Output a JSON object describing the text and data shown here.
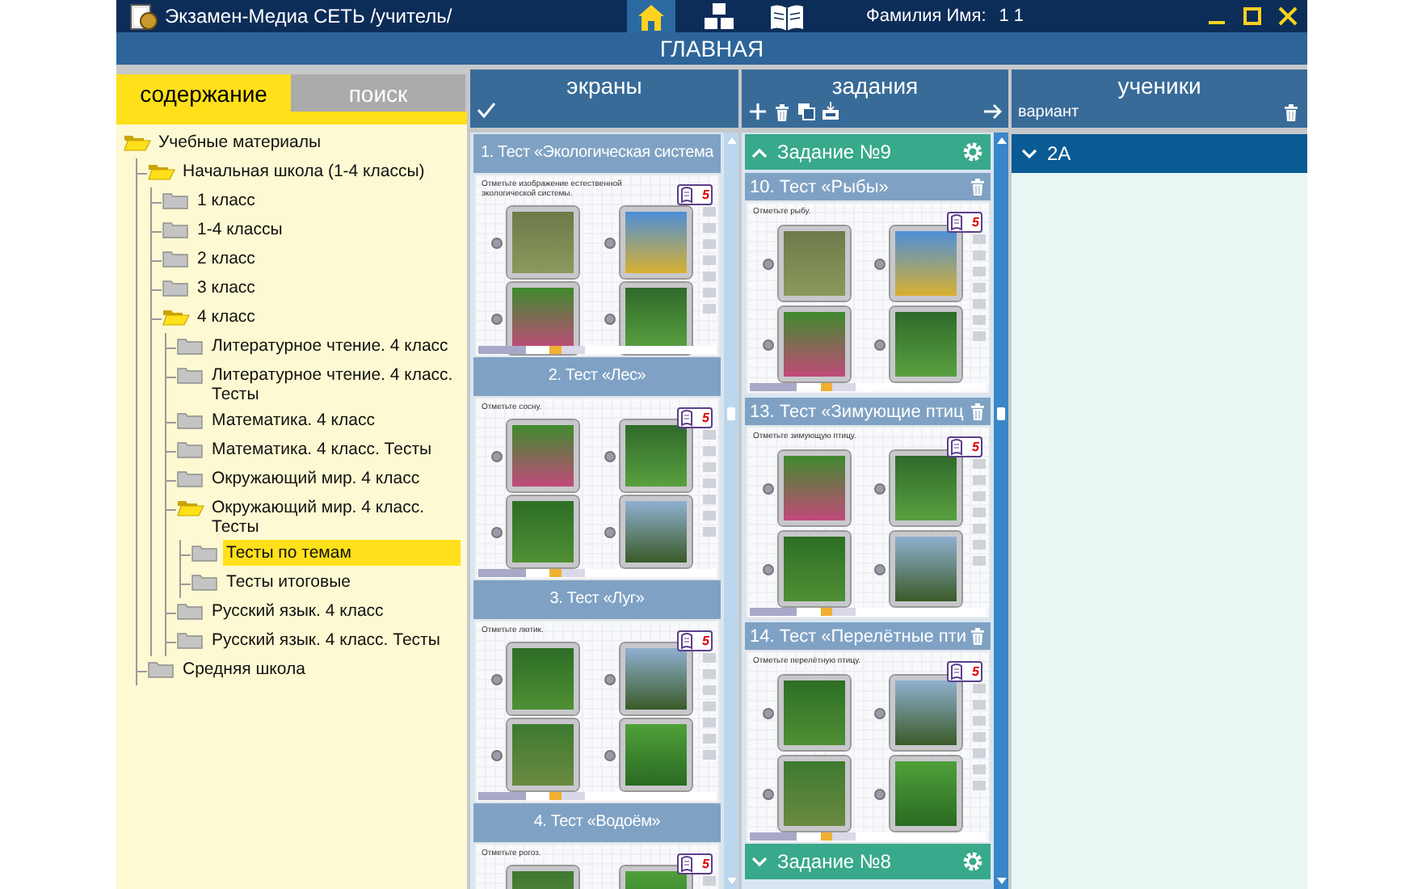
{
  "window": {
    "title": "Экзамен-Медиа СЕТЬ /учитель/",
    "user_label": "Фамилия Имя:",
    "user_value": "1 1"
  },
  "nav": [
    {
      "kind": "home",
      "selected": true
    },
    {
      "kind": "blocks",
      "selected": false
    },
    {
      "kind": "book",
      "selected": false
    }
  ],
  "page_title": "ГЛАВНАЯ",
  "left_tabs": [
    {
      "label": "содержание",
      "selected": true
    },
    {
      "label": "поиск",
      "selected": false
    }
  ],
  "tree": [
    {
      "label": "Учебные материалы",
      "expanded": true,
      "selected": false,
      "children": [
        {
          "label": "Начальная школа (1-4 классы)",
          "expanded": true,
          "selected": false,
          "children": [
            {
              "label": "1 класс",
              "expanded": false,
              "selected": false
            },
            {
              "label": "1-4 классы",
              "expanded": false,
              "selected": false
            },
            {
              "label": "2 класс",
              "expanded": false,
              "selected": false
            },
            {
              "label": "3 класс",
              "expanded": false,
              "selected": false
            },
            {
              "label": "4 класс",
              "expanded": true,
              "selected": false,
              "children": [
                {
                  "label": "Литературное чтение. 4 класс",
                  "expanded": false,
                  "selected": false
                },
                {
                  "label": "Литературное чтение. 4 класс. Тесты",
                  "expanded": false,
                  "selected": false
                },
                {
                  "label": "Математика. 4 класс",
                  "expanded": false,
                  "selected": false
                },
                {
                  "label": "Математика. 4 класс. Тесты",
                  "expanded": false,
                  "selected": false
                },
                {
                  "label": "Окружающий мир. 4 класс",
                  "expanded": false,
                  "selected": false
                },
                {
                  "label": "Окружающий мир. 4 класс. Тесты",
                  "expanded": true,
                  "selected": false,
                  "children": [
                    {
                      "label": "Тесты по темам",
                      "expanded": false,
                      "selected": true
                    },
                    {
                      "label": "Тесты итоговые",
                      "expanded": false,
                      "selected": false
                    }
                  ]
                },
                {
                  "label": "Русский язык. 4 класс",
                  "expanded": false,
                  "selected": false
                },
                {
                  "label": "Русский язык. 4 класс. Тесты",
                  "expanded": false,
                  "selected": false
                }
              ]
            }
          ]
        },
        {
          "label": "Средняя школа",
          "expanded": false,
          "selected": false
        }
      ]
    }
  ],
  "screens": {
    "title": "экраны",
    "items": [
      {
        "title": "1. Тест «Экологическая система",
        "question": "Отметьте изображение естественной экологической системы.",
        "badge": "5"
      },
      {
        "title": "2. Тест «Лес»",
        "question": "Отметьте сосну.",
        "badge": "5"
      },
      {
        "title": "3. Тест «Луг»",
        "question": "Отметьте лютик.",
        "badge": "5"
      },
      {
        "title": "4. Тест «Водоём»",
        "question": "Отметьте рогоз.",
        "badge": "5"
      }
    ]
  },
  "tasks": {
    "title": "задания",
    "groups": [
      {
        "title": "Задание №9",
        "expanded": true,
        "items": [
          {
            "title": "10. Тест «Рыбы»",
            "question": "Отметьте рыбу.",
            "badge": "5"
          },
          {
            "title": "13. Тест «Зимующие птиц",
            "question": "Отметьте зимующую птицу.",
            "badge": "5"
          },
          {
            "title": "14. Тест «Перелётные пти",
            "question": "Отметьте перелётную птицу.",
            "badge": "5"
          }
        ]
      },
      {
        "title": "Задание №8",
        "expanded": false
      }
    ]
  },
  "students": {
    "title": "ученики",
    "label": "вариант",
    "groups": [
      {
        "name": "2А",
        "expanded": false
      }
    ]
  }
}
